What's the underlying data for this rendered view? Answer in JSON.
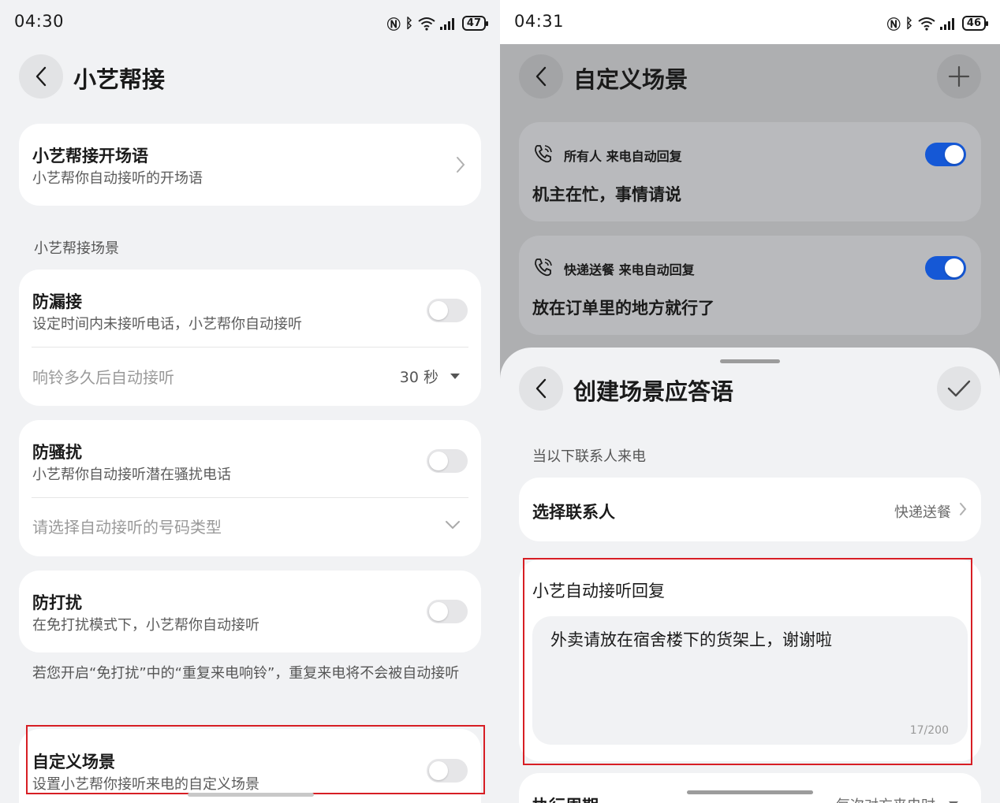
{
  "left": {
    "status": {
      "time": "04:30",
      "battery": "47"
    },
    "title": "小艺帮接",
    "greeting": {
      "title": "小艺帮接开场语",
      "subtitle": "小艺帮你自动接听的开场语"
    },
    "section_label": "小艺帮接场景",
    "missed": {
      "title": "防漏接",
      "subtitle": "设定时间内未接听电话，小艺帮你自动接听",
      "option_label": "响铃多久后自动接听",
      "option_value": "30 秒",
      "enabled": false
    },
    "harass": {
      "title": "防骚扰",
      "subtitle": "小艺帮你自动接听潜在骚扰电话",
      "option_label": "请选择自动接听的号码类型",
      "enabled": false
    },
    "dnd": {
      "title": "防打扰",
      "subtitle": "在免打扰模式下，小艺帮你自动接听",
      "enabled": false
    },
    "note": "若您开启“免打扰”中的“重复来电响铃”，重复来电将不会被自动接听",
    "custom": {
      "title": "自定义场景",
      "subtitle": "设置小艺帮你接听来电的自定义场景",
      "enabled": false
    }
  },
  "right": {
    "status": {
      "time": "04:31",
      "battery": "46"
    },
    "title": "自定义场景",
    "scenes": [
      {
        "contact": "所有人",
        "suffix": "来电自动回复",
        "reply": "机主在忙，事情请说",
        "enabled": true
      },
      {
        "contact": "快递送餐",
        "suffix": "来电自动回复",
        "reply": "放在订单里的地方就行了",
        "enabled": true
      }
    ],
    "sheet": {
      "title": "创建场景应答语",
      "section_label": "当以下联系人来电",
      "contact_row": {
        "label": "选择联系人",
        "value": "快递送餐"
      },
      "reply_label": "小艺自动接听回复",
      "reply_text": "外卖请放在宿舍楼下的货架上，谢谢啦",
      "reply_count": "17/200",
      "cycle_label": "执行周期",
      "cycle_value": "每次对方来电时"
    }
  },
  "colors": {
    "accent": "#1558d6",
    "highlight": "#d71e24"
  }
}
